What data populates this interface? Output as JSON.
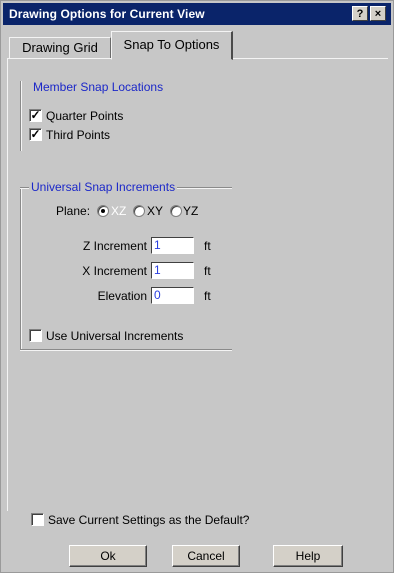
{
  "window": {
    "title": "Drawing Options for Current View",
    "help_glyph": "?",
    "close_glyph": "×"
  },
  "tabs": [
    {
      "label": "Drawing Grid",
      "active": false
    },
    {
      "label": "Snap To Options",
      "active": true
    }
  ],
  "member_snap": {
    "title": "Member Snap Locations",
    "options": [
      {
        "label": "Quarter Points",
        "checked": true
      },
      {
        "label": "Third Points",
        "checked": true
      }
    ]
  },
  "universal_snap": {
    "title": "Universal Snap Increments",
    "plane_label": "Plane:",
    "planes": [
      {
        "label": "XZ",
        "selected": true
      },
      {
        "label": "XY",
        "selected": false
      },
      {
        "label": "YZ",
        "selected": false
      }
    ],
    "fields": [
      {
        "label": "Z Increment",
        "value": "1",
        "unit": "ft"
      },
      {
        "label": "X Increment",
        "value": "1",
        "unit": "ft"
      },
      {
        "label": "Elevation",
        "value": "0",
        "unit": "ft"
      }
    ],
    "use_increments": {
      "label": "Use Universal Increments",
      "checked": false
    }
  },
  "save_default": {
    "label": "Save Current Settings as the Default?",
    "checked": false
  },
  "buttons": {
    "ok": "Ok",
    "cancel": "Cancel",
    "help": "Help"
  },
  "check_glyph": "✓"
}
